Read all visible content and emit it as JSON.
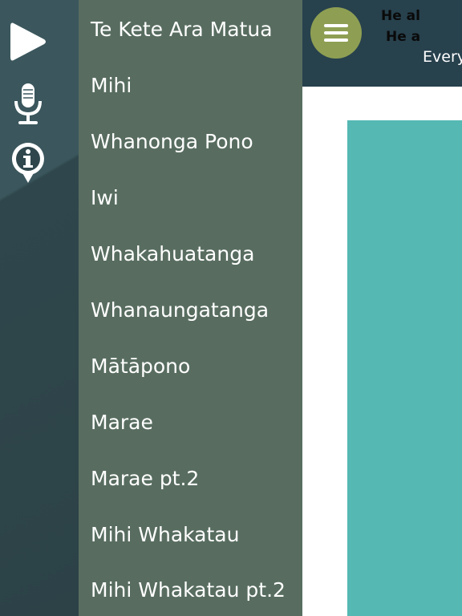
{
  "rail": {
    "icons": [
      "play-icon",
      "microphone-icon",
      "info-icon"
    ]
  },
  "menu": {
    "items": [
      {
        "label": "Te Kete Ara Matua"
      },
      {
        "label": "Mihi"
      },
      {
        "label": "Whanonga Pono"
      },
      {
        "label": "Iwi"
      },
      {
        "label": "Whakahuatanga"
      },
      {
        "label": "Whanaungatanga"
      },
      {
        "label": "Mātāpono"
      },
      {
        "label": "Marae"
      },
      {
        "label": "Marae pt.2"
      },
      {
        "label": "Mihi Whakatau"
      },
      {
        "label": "Mihi Whakatau pt.2"
      }
    ]
  },
  "header": {
    "menu_icon": "hamburger-icon",
    "title_partial": "Every"
  },
  "card": {
    "line1": "He al",
    "line2": "He a"
  },
  "colors": {
    "rail_bg": "#3b575d",
    "menu_bg": "#586d60",
    "topbar_bg": "#27414d",
    "menu_toggle": "#8e9f53",
    "card_bg": "#55b8b3"
  }
}
